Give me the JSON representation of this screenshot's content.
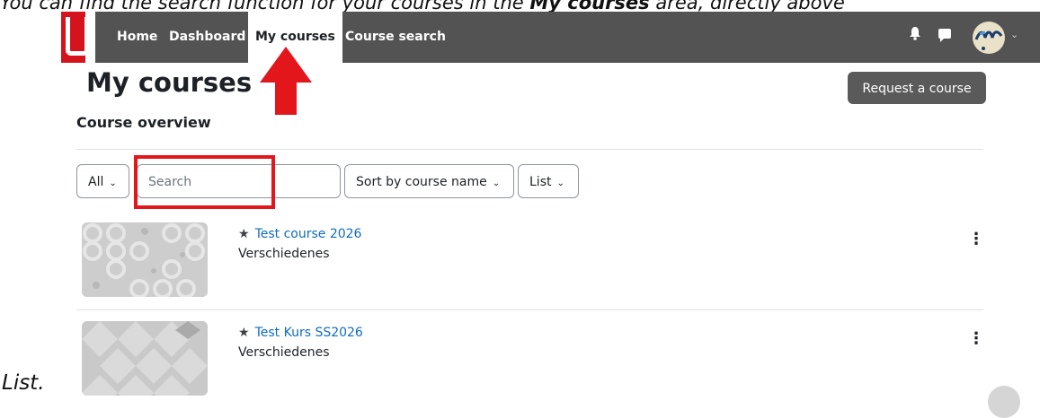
{
  "intro": {
    "text_before": "You can find the search function for your courses in the ",
    "text_bold": "My courses",
    "text_after": " area, directly above"
  },
  "navbar": {
    "items": [
      {
        "label": "Home"
      },
      {
        "label": "Dashboard"
      },
      {
        "label": "My courses",
        "active": true
      },
      {
        "label": "Course search"
      }
    ]
  },
  "page": {
    "title": "My courses",
    "request_button": "Request a course",
    "section_title": "Course overview"
  },
  "filters": {
    "grouping": "All",
    "search_placeholder": "Search",
    "sort": "Sort by course name",
    "view": "List"
  },
  "courses": [
    {
      "name": "Test course 2026",
      "category": "Verschiedenes"
    },
    {
      "name": "Test Kurs SS2026",
      "category": "Verschiedenes"
    }
  ],
  "caption": "List.",
  "colors": {
    "navbar": "#535353",
    "link": "#0f6cbf",
    "annotation_red": "#e3161c",
    "logo_red": "#d5131d"
  }
}
